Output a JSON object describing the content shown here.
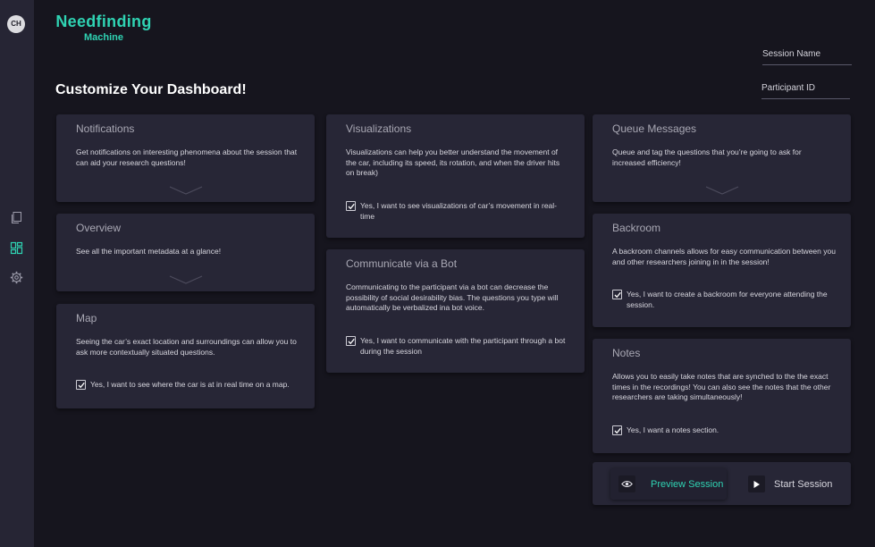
{
  "user": {
    "initials": "CH"
  },
  "brand": {
    "title": "Needfinding",
    "subtitle": "Machine"
  },
  "sidebar": {
    "items": [
      {
        "icon": "copy-icon"
      },
      {
        "icon": "dashboard-icon",
        "active": true
      },
      {
        "icon": "gear-icon"
      }
    ]
  },
  "page": {
    "title": "Customize Your Dashboard!"
  },
  "fields": {
    "session_name": "Session Name",
    "participant_id": "Participant ID"
  },
  "colors": {
    "accent": "#2fd3b3",
    "background": "#16151e",
    "card": "#272636",
    "sidebar": "#262534"
  },
  "cards": {
    "notifications": {
      "title": "Notifications",
      "desc": "Get notifications on interesting phenomena about the session that can aid your research questions!"
    },
    "overview": {
      "title": "Overview",
      "desc": "See all the important metadata at a glance!"
    },
    "map": {
      "title": "Map",
      "desc": "Seeing the car’s exact location and surroundings can allow you to ask more contextually situated questions.",
      "option": "Yes, I want to see where the car is at in real time on a map.",
      "checked": true
    },
    "visualizations": {
      "title": "Visualizations",
      "desc": "Visualizations can help you better understand the movement of the car, including its speed, its rotation, and when the driver hits on break)",
      "option": "Yes, I want to see visualizations of car’s movement in real-time",
      "checked": true
    },
    "bot": {
      "title": "Communicate via a Bot",
      "desc": "Communicating to the participant via a bot can decrease the possibility of social desirability bias. The questions you type will automatically be verbalized ina bot voice.",
      "option": "Yes, I want to communicate with the participant through a bot during the session",
      "checked": true
    },
    "queue": {
      "title": "Queue Messages",
      "desc": "Queue and tag the questions that you’re going to ask for increased efficiency!"
    },
    "backroom": {
      "title": "Backroom",
      "desc": "A backroom channels allows for easy communication between you and other researchers joining in in the session!",
      "option": "Yes, I want to create a backroom for everyone attending the session.",
      "checked": true
    },
    "notes": {
      "title": "Notes",
      "desc": "Allows you to easily take notes that are synched to the the exact times in the recordings! You can also see the notes that the other researchers are taking simultaneously!",
      "option": "Yes, I want a notes section.",
      "checked": true
    }
  },
  "actions": {
    "preview": "Preview Session",
    "start": "Start Session"
  }
}
